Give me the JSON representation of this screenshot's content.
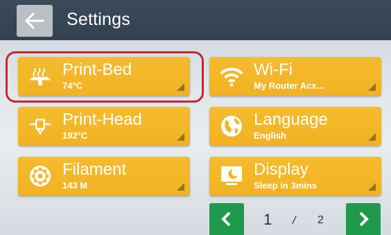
{
  "header": {
    "title": "Settings",
    "back_icon": "arrow-left-icon"
  },
  "tiles": [
    {
      "id": "print-bed",
      "label": "Print-Bed",
      "value": "74°C",
      "icon": "heated-bed-icon"
    },
    {
      "id": "wifi",
      "label": "Wi-Fi",
      "value": "My Router Acx...",
      "icon": "wifi-icon"
    },
    {
      "id": "print-head",
      "label": "Print-Head",
      "value": "192°C",
      "icon": "nozzle-icon"
    },
    {
      "id": "language",
      "label": "Language",
      "value": "English",
      "icon": "globe-icon"
    },
    {
      "id": "filament",
      "label": "Filament",
      "value": "143 M",
      "icon": "filament-spool-icon"
    },
    {
      "id": "display",
      "label": "Display",
      "value": "Sleep in 3mins",
      "icon": "display-sleep-icon"
    }
  ],
  "pager": {
    "current": "1",
    "separator": "/",
    "total": "2"
  },
  "colors": {
    "tile": "#f3b627",
    "header": "#37454f",
    "pager": "#1f9a4c",
    "highlight": "#c8252e"
  }
}
